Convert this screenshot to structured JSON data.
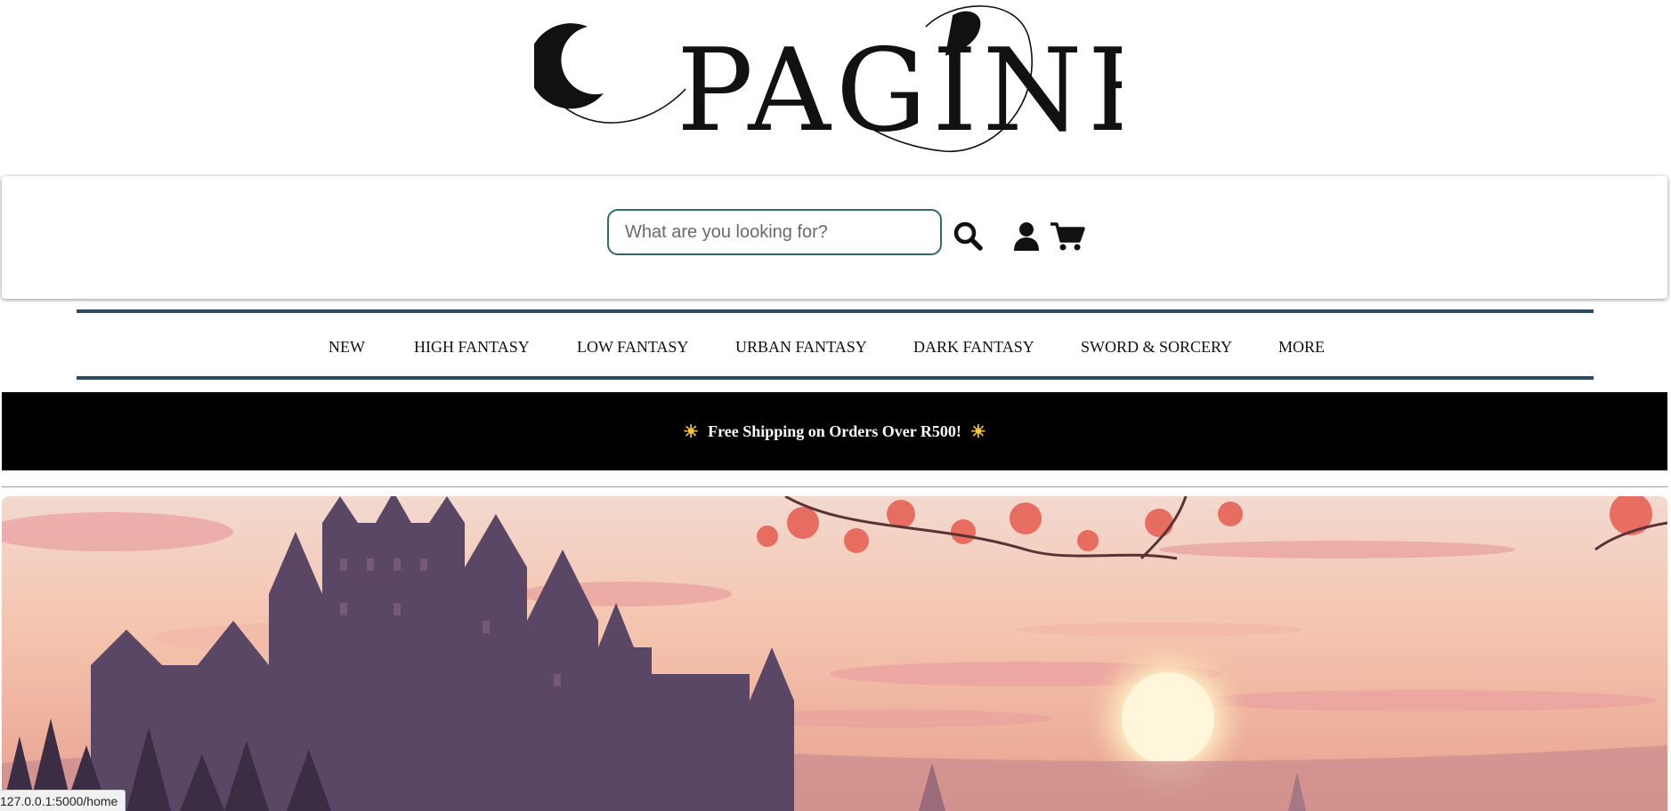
{
  "logo": {
    "text": "PAGINE"
  },
  "search": {
    "placeholder": "What are you looking for?"
  },
  "header_icons": [
    "search-icon",
    "user-icon",
    "cart-icon"
  ],
  "nav": {
    "items": [
      "NEW",
      "HIGH FANTASY",
      "LOW FANTASY",
      "URBAN FANTASY",
      "DARK FANTASY",
      "SWORD & SORCERY",
      "MORE"
    ]
  },
  "promo": {
    "text": "Free Shipping on Orders Over R500!"
  },
  "colors": {
    "nav_border": "#2d4a63",
    "search_border": "#2f6a6a",
    "promo_bg": "#000000",
    "sun": "#f6c63a"
  },
  "status_bar": {
    "url": "127.0.0.1:5000/home"
  }
}
